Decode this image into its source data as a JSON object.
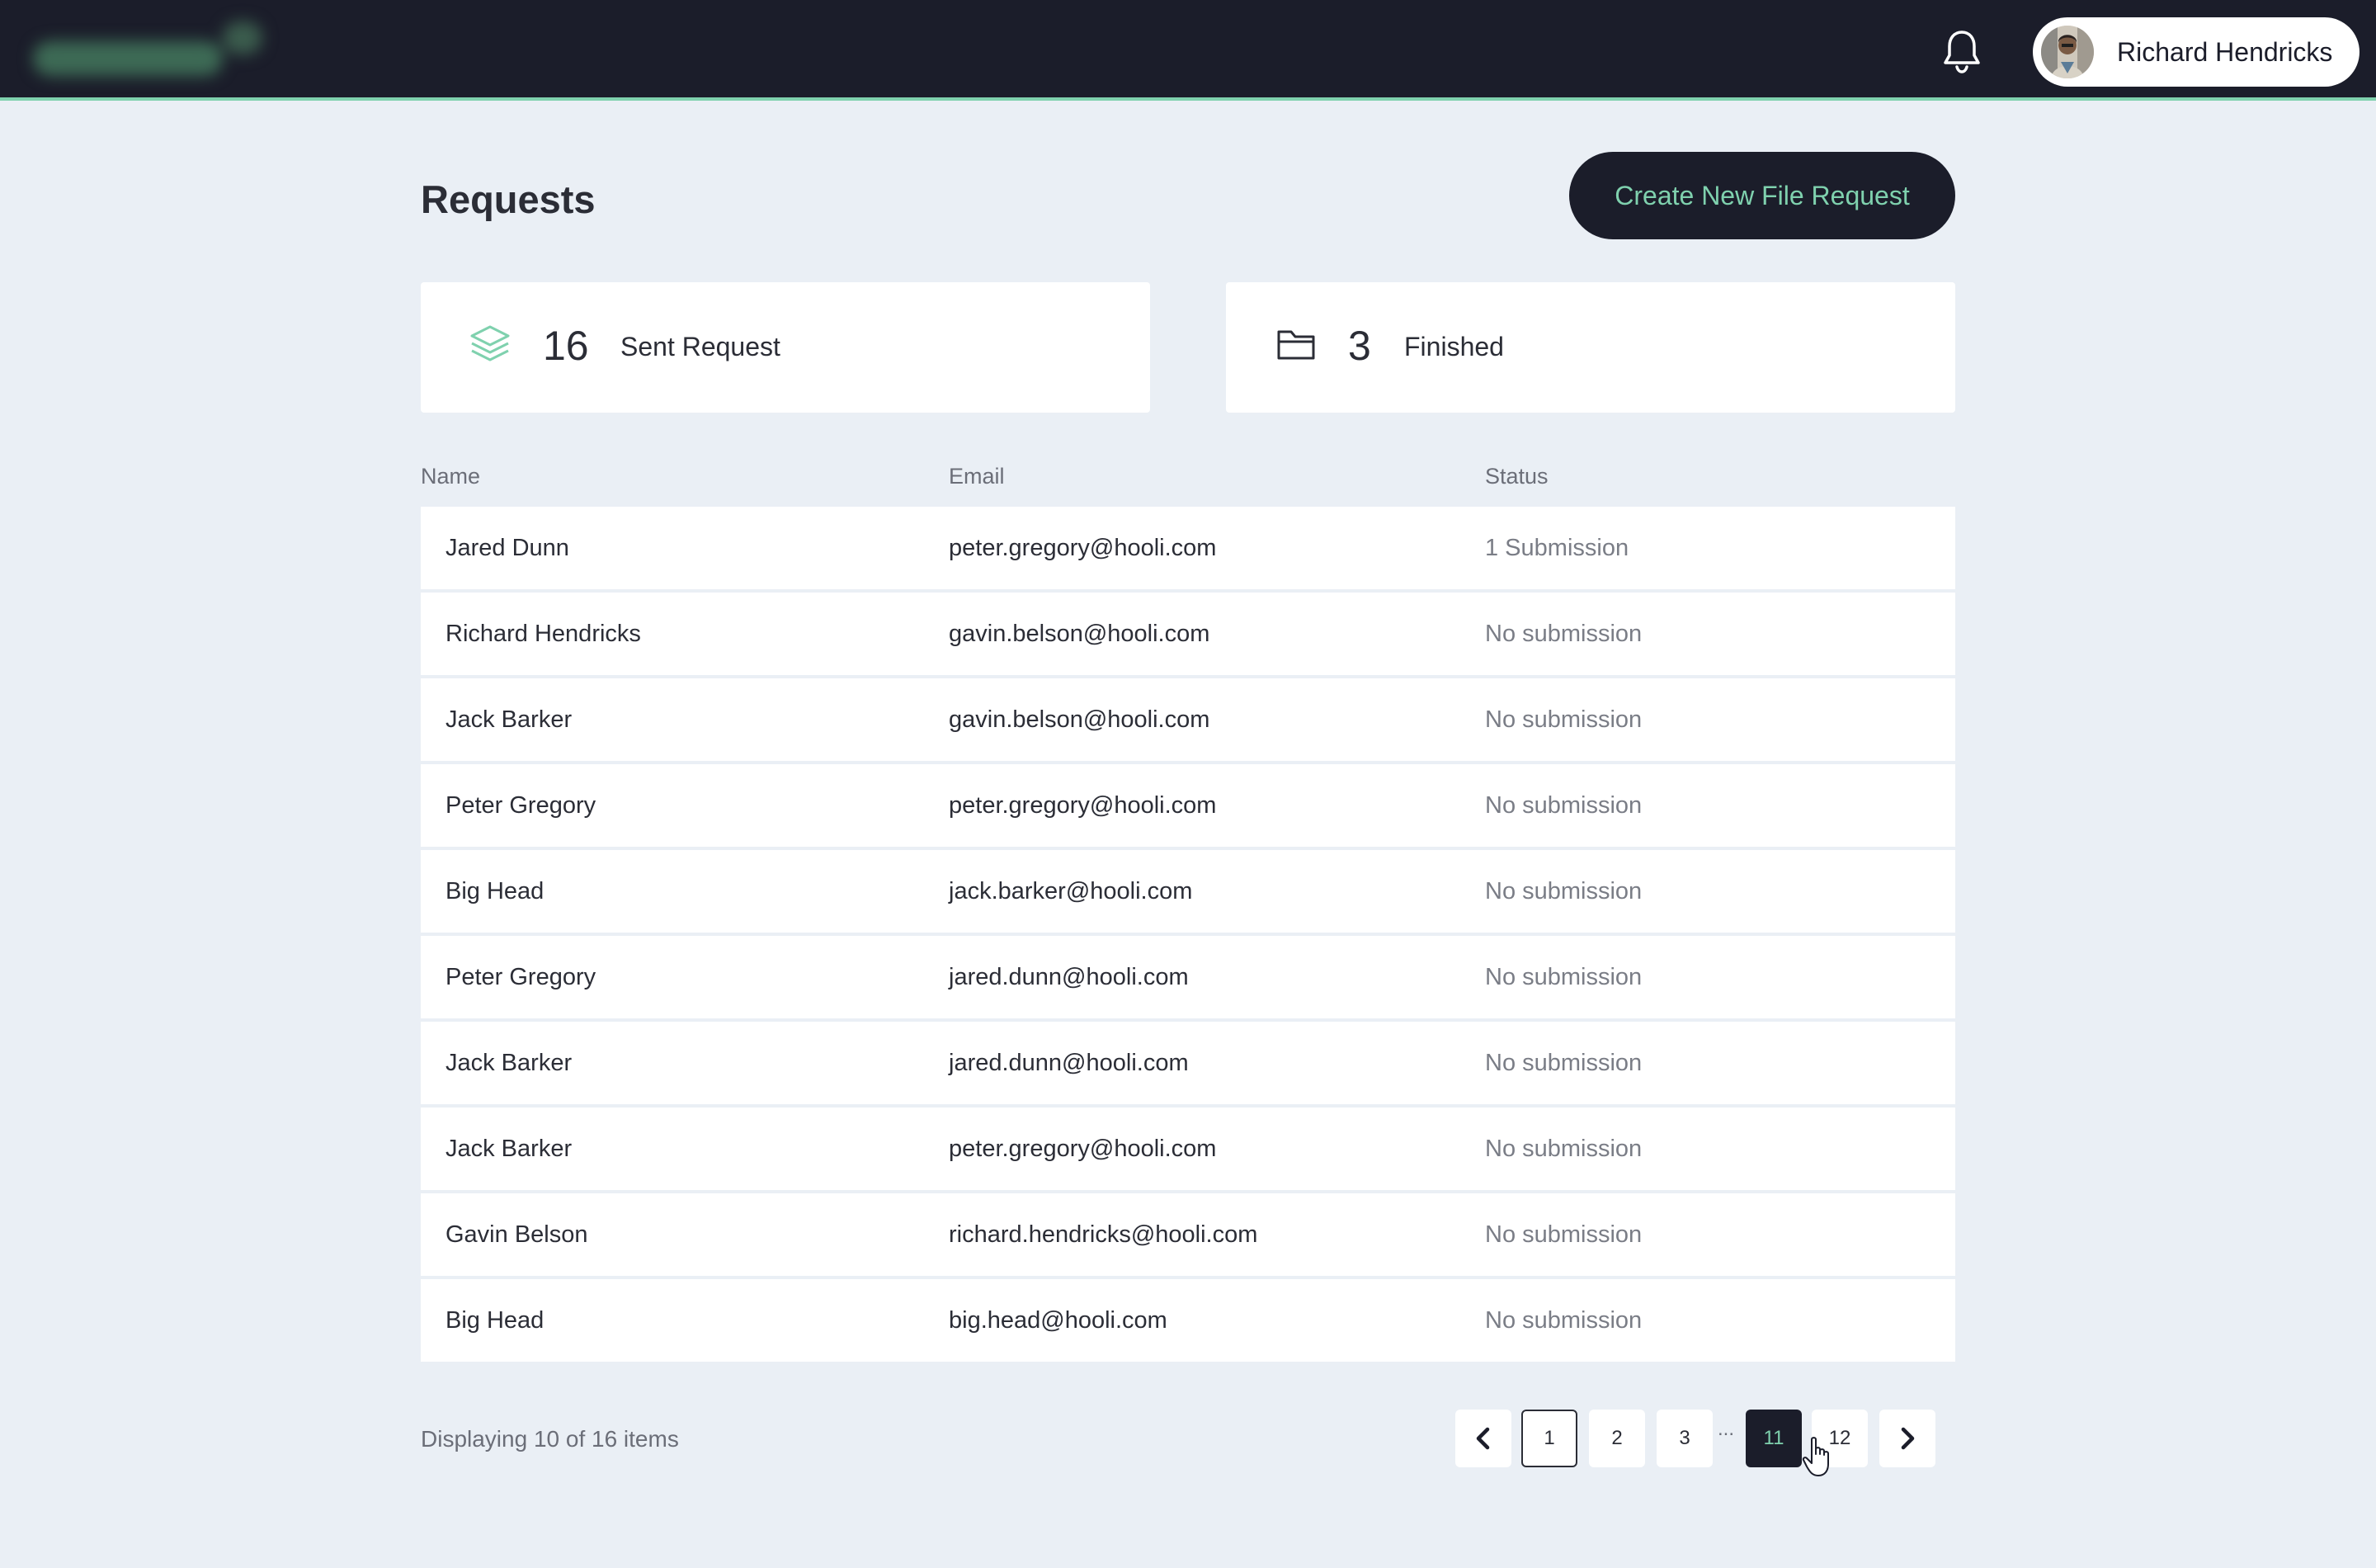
{
  "app": {
    "icons": {
      "bell": "bell-icon",
      "sent": "layers-icon",
      "finished": "folder-icon",
      "prev": "chevron-left-icon",
      "next": "chevron-right-icon"
    },
    "colors": {
      "accent": "#7fd1ae",
      "dark": "#1b1d2a",
      "background": "#eaeff5"
    }
  },
  "header": {
    "user_name": "Richard Hendricks"
  },
  "page": {
    "title": "Requests",
    "create_button": "Create New File Request"
  },
  "stats": {
    "sent": {
      "count": "16",
      "label": "Sent Request"
    },
    "finished": {
      "count": "3",
      "label": "Finished"
    }
  },
  "table": {
    "columns": [
      "Name",
      "Email",
      "Status"
    ],
    "rows": [
      {
        "name": "Jared Dunn",
        "email": "peter.gregory@hooli.com",
        "status": "1 Submission"
      },
      {
        "name": "Richard Hendricks",
        "email": "gavin.belson@hooli.com",
        "status": "No submission"
      },
      {
        "name": "Jack Barker",
        "email": "gavin.belson@hooli.com",
        "status": "No submission"
      },
      {
        "name": "Peter Gregory",
        "email": "peter.gregory@hooli.com",
        "status": "No submission"
      },
      {
        "name": "Big Head",
        "email": "jack.barker@hooli.com",
        "status": "No submission"
      },
      {
        "name": "Peter Gregory",
        "email": "jared.dunn@hooli.com",
        "status": "No submission"
      },
      {
        "name": "Jack Barker",
        "email": "jared.dunn@hooli.com",
        "status": "No submission"
      },
      {
        "name": "Jack Barker",
        "email": "peter.gregory@hooli.com",
        "status": "No submission"
      },
      {
        "name": "Gavin Belson",
        "email": "richard.hendricks@hooli.com",
        "status": "No submission"
      },
      {
        "name": "Big Head",
        "email": "big.head@hooli.com",
        "status": "No submission"
      }
    ]
  },
  "footer": {
    "display_info": "Displaying 10 of 16 items",
    "pages": [
      "1",
      "2",
      "3",
      "11",
      "12"
    ],
    "ellipsis": "...",
    "current_page": "11"
  }
}
